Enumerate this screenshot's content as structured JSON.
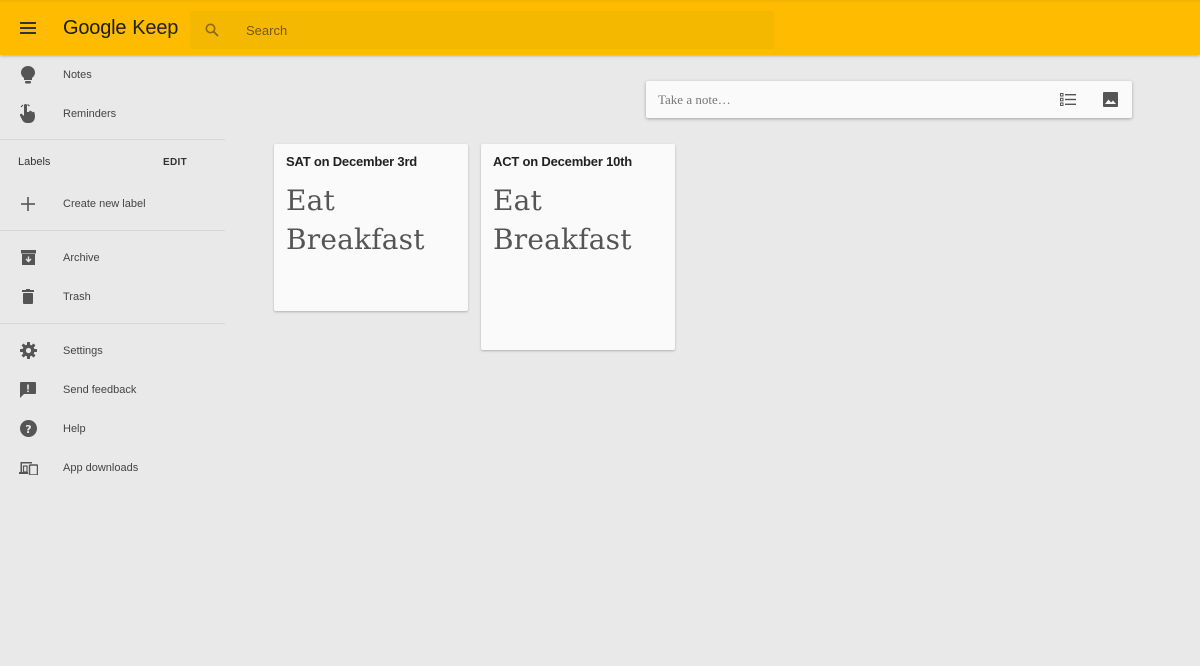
{
  "header": {
    "brand_first": "Google",
    "brand_second": "Keep",
    "search_placeholder": "Search",
    "accent_color": "#ffbb00"
  },
  "sidebar": {
    "top_items": [
      {
        "label": "Notes",
        "icon": "lightbulb-icon"
      },
      {
        "label": "Reminders",
        "icon": "reminder-hand-icon"
      }
    ],
    "labels_title": "Labels",
    "labels_edit": "EDIT",
    "create_label": "Create new label",
    "mid_items": [
      {
        "label": "Archive",
        "icon": "archive-icon"
      },
      {
        "label": "Trash",
        "icon": "trash-icon"
      }
    ],
    "bottom_items": [
      {
        "label": "Settings",
        "icon": "gear-icon"
      },
      {
        "label": "Send feedback",
        "icon": "feedback-icon"
      },
      {
        "label": "Help",
        "icon": "help-icon"
      },
      {
        "label": "App downloads",
        "icon": "devices-icon"
      }
    ]
  },
  "take_note": {
    "placeholder": "Take a note…"
  },
  "notes": [
    {
      "title": "SAT on December 3rd",
      "body_line1": "Eat",
      "body_line2": "Breakfast"
    },
    {
      "title": "ACT on December 10th",
      "body_line1": "Eat",
      "body_line2": "Breakfast"
    }
  ]
}
